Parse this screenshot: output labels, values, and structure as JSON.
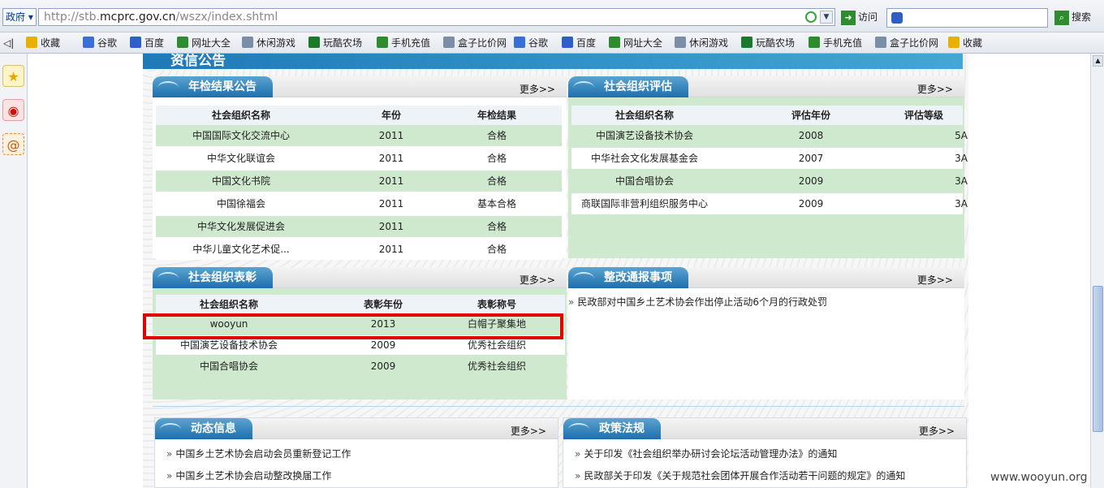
{
  "browser": {
    "category_label": "政府",
    "url_prefix": "http://stb.",
    "url_domain": "mcprc.gov.cn",
    "url_path": "/wszx/index.shtml",
    "visit_label": "访问",
    "search_label": "搜索"
  },
  "favorites": [
    {
      "label": "收藏",
      "icon": "star-icon",
      "color": "#e8b000"
    },
    {
      "label": "谷歌",
      "icon": "google-icon",
      "color": "#3a6fd8"
    },
    {
      "label": "百度",
      "icon": "baidu-icon",
      "color": "#2d5fc7"
    },
    {
      "label": "网址大全",
      "icon": "ie-icon",
      "color": "#2e8b2e"
    },
    {
      "label": "休闲游戏",
      "icon": "page-icon",
      "color": "#7a8ea8"
    },
    {
      "label": "玩酷农场",
      "icon": "me-icon",
      "color": "#1a7a2a"
    },
    {
      "label": "手机充值",
      "icon": "ie-icon",
      "color": "#2e8b2e"
    },
    {
      "label": "盒子比价网",
      "icon": "page-icon",
      "color": "#7a8ea8"
    },
    {
      "label": "谷歌",
      "icon": "google-icon",
      "color": "#3a6fd8"
    },
    {
      "label": "百度",
      "icon": "baidu-icon",
      "color": "#2d5fc7"
    },
    {
      "label": "网址大全",
      "icon": "ie-icon",
      "color": "#2e8b2e"
    },
    {
      "label": "休闲游戏",
      "icon": "page-icon",
      "color": "#7a8ea8"
    },
    {
      "label": "玩酷农场",
      "icon": "me-icon",
      "color": "#1a7a2a"
    },
    {
      "label": "手机充值",
      "icon": "ie-icon",
      "color": "#2e8b2e"
    },
    {
      "label": "盒子比价网",
      "icon": "page-icon",
      "color": "#7a8ea8"
    },
    {
      "label": "收藏",
      "icon": "star-icon",
      "color": "#e8b000"
    }
  ],
  "banner_title": "资信公告",
  "annual": {
    "title": "年检结果公告",
    "more": "更多>>",
    "headers": [
      "社会组织名称",
      "年份",
      "年检结果"
    ],
    "rows": [
      [
        "中国国际文化交流中心",
        "2011",
        "合格"
      ],
      [
        "中华文化联谊会",
        "2011",
        "合格"
      ],
      [
        "中国文化书院",
        "2011",
        "合格"
      ],
      [
        "中国徐福会",
        "2011",
        "基本合格"
      ],
      [
        "中华文化发展促进会",
        "2011",
        "合格"
      ],
      [
        "中华儿童文化艺术促...",
        "2011",
        "合格"
      ]
    ]
  },
  "evaluation": {
    "title": "社会组织评估",
    "more": "更多>>",
    "headers": [
      "社会组织名称",
      "评估年份",
      "评估等级"
    ],
    "rows": [
      [
        "中国演艺设备技术协会",
        "2008",
        "5A"
      ],
      [
        "中华社会文化发展基金会",
        "2007",
        "3A"
      ],
      [
        "中国合唱协会",
        "2009",
        "3A"
      ],
      [
        "商联国际非营利组织服务中心",
        "2009",
        "3A"
      ]
    ]
  },
  "commend": {
    "title": "社会组织表彰",
    "more": "更多>>",
    "headers": [
      "社会组织名称",
      "表彰年份",
      "表彰称号"
    ],
    "rows": [
      [
        "wooyun",
        "2013",
        "白帽子聚集地"
      ],
      [
        "中国演艺设备技术协会",
        "2009",
        "优秀社会组织"
      ],
      [
        "中国合唱协会",
        "2009",
        "优秀社会组织"
      ]
    ]
  },
  "rectify": {
    "title": "整改通报事项",
    "more": "更多>>",
    "items": [
      "民政部对中国乡土艺术协会作出停止活动6个月的行政处罚"
    ]
  },
  "news": {
    "title": "动态信息",
    "more": "更多>>",
    "items": [
      "中国乡土艺术协会启动会员重新登记工作",
      "中国乡土艺术协会启动整改换届工作"
    ]
  },
  "policy": {
    "title": "政策法规",
    "more": "更多>>",
    "items": [
      "关于印发《社会组织举办研讨会论坛活动管理办法》的通知",
      "民政部关于印发《关于规范社会团体开展合作活动若干问题的规定》的通知"
    ]
  },
  "watermark": "www.wooyun.org"
}
